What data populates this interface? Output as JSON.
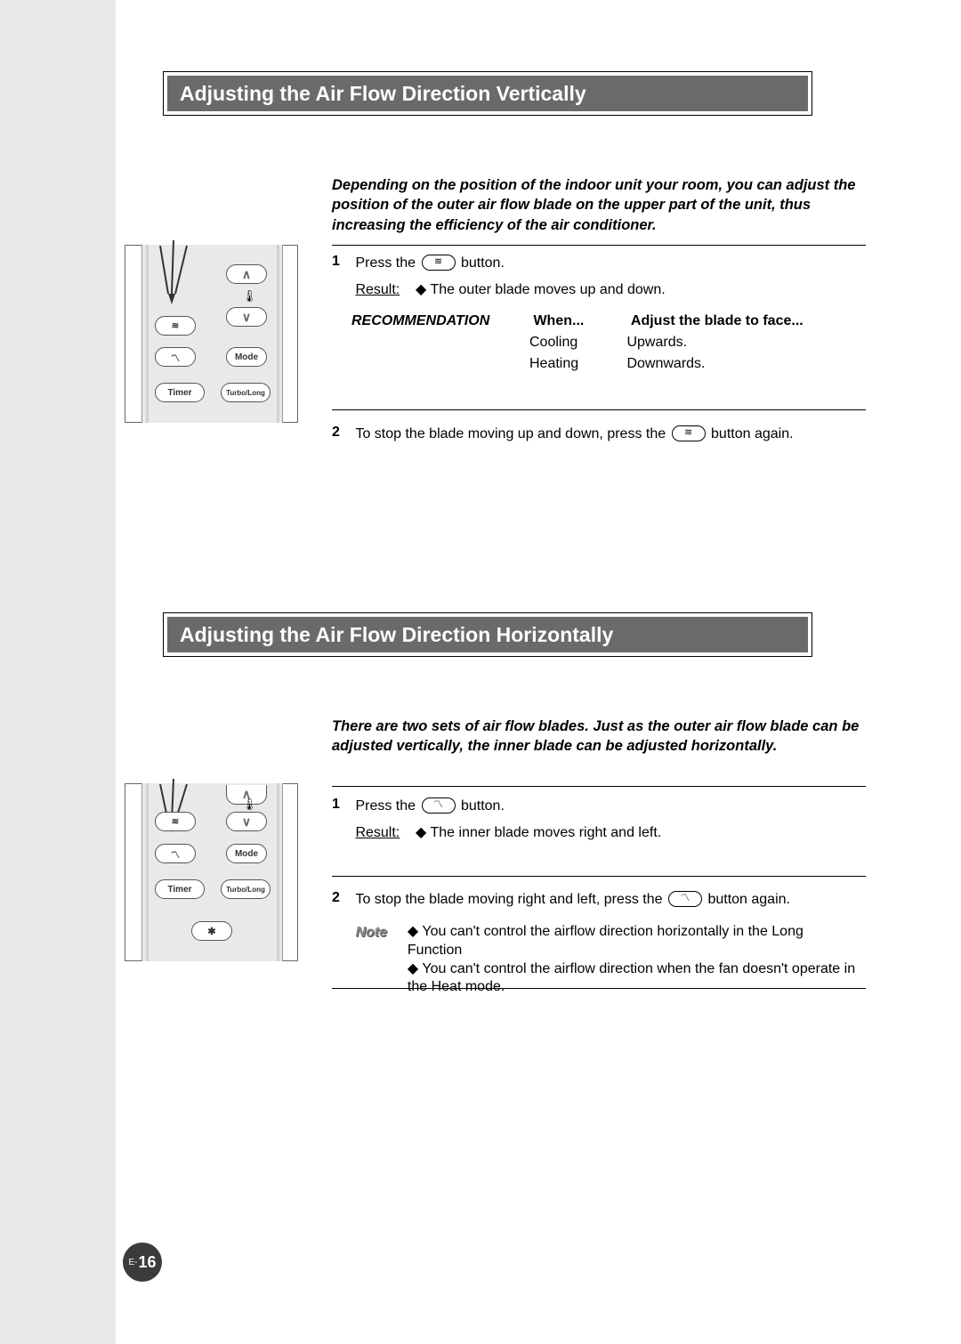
{
  "sections": {
    "vertical": {
      "title": "Adjusting the Air Flow Direction Vertically",
      "intro": "Depending on the position of the indoor unit your room, you can adjust the position of the outer air flow blade on the upper part of the unit, thus increasing the efficiency of the air conditioner.",
      "step1_pre": "Press the",
      "step1_post": "button.",
      "step1_result_label": "Result:",
      "step1_result_text": "The outer blade moves up and down.",
      "rec_label": "RECOMMENDATION",
      "rec_h1": "When...",
      "rec_h2": "Adjust the blade to face...",
      "rec_rows": [
        {
          "when": "Cooling",
          "face": "Upwards."
        },
        {
          "when": "Heating",
          "face": "Downwards."
        }
      ],
      "step2_pre": "To stop the blade moving up and down, press the",
      "step2_post": "button again."
    },
    "horizontal": {
      "title": "Adjusting the Air Flow Direction Horizontally",
      "intro": "There are two sets of air flow blades. Just as the outer air flow blade can be adjusted vertically, the inner blade can be adjusted horizontally.",
      "step1_pre": "Press the",
      "step1_post": "button.",
      "step1_result_label": "Result:",
      "step1_result_text": "The inner blade moves right and left.",
      "step2_pre": "To stop the blade moving right and left, press the",
      "step2_post": "button again.",
      "note_label": "Note",
      "note1": "You can't control the airflow direction horizontally in the Long Function",
      "note2": "You can't control the airflow direction when the fan doesn't operate in the Heat mode."
    }
  },
  "remote": {
    "mode": "Mode",
    "timer": "Timer",
    "turbo": "Turbo/Long"
  },
  "page": {
    "prefix": "E-",
    "num": "16"
  },
  "glyphs": {
    "swing_v": "≋",
    "swing_h": "〽",
    "up": "∧",
    "down": "∨",
    "fan": "✱"
  }
}
